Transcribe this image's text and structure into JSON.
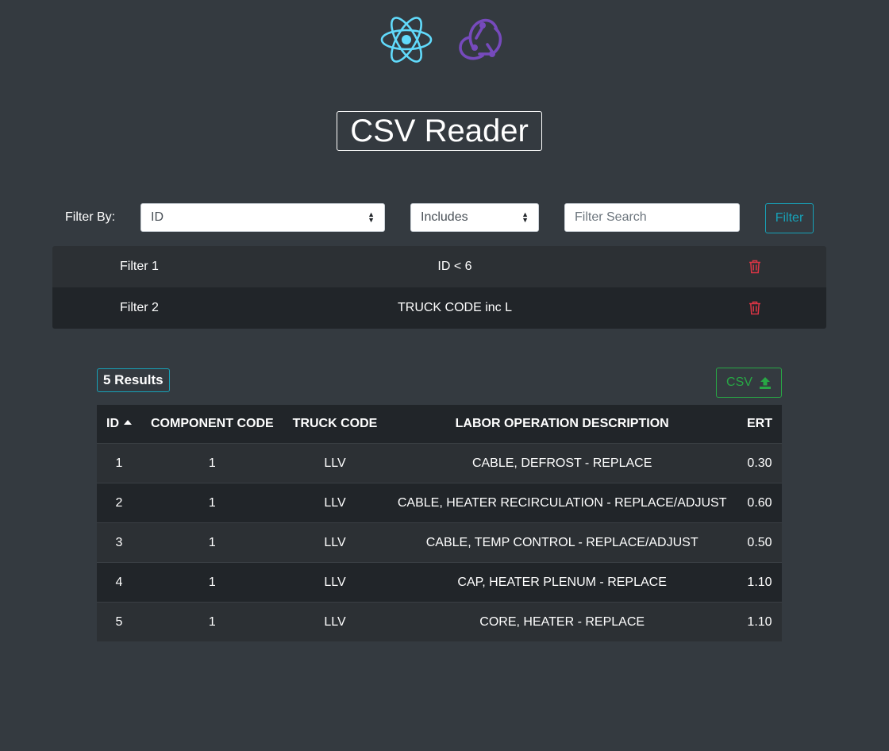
{
  "logos": {
    "react": "react-logo",
    "redux": "redux-logo",
    "react_color": "#61dafb",
    "redux_color": "#764abc"
  },
  "title": "CSV Reader",
  "filter_bar": {
    "label": "Filter By:",
    "field_select": {
      "selected": "ID"
    },
    "operator_select": {
      "selected": "Includes"
    },
    "search": {
      "value": "",
      "placeholder": "Filter Search"
    },
    "filter_button": "Filter"
  },
  "active_filters": [
    {
      "name": "Filter 1",
      "expression": "ID < 6"
    },
    {
      "name": "Filter 2",
      "expression": "TRUCK CODE inc L"
    }
  ],
  "results": {
    "count_label": "5 Results",
    "csv_button": "CSV",
    "columns": [
      "ID",
      "COMPONENT CODE",
      "TRUCK CODE",
      "LABOR OPERATION DESCRIPTION",
      "ERT"
    ],
    "sorted_column": "ID",
    "sort_direction": "ascending",
    "rows": [
      [
        "1",
        "1",
        "LLV",
        "CABLE, DEFROST - REPLACE",
        "0.30"
      ],
      [
        "2",
        "1",
        "LLV",
        "CABLE, HEATER RECIRCULATION - REPLACE/ADJUST",
        "0.60"
      ],
      [
        "3",
        "1",
        "LLV",
        "CABLE, TEMP CONTROL - REPLACE/ADJUST",
        "0.50"
      ],
      [
        "4",
        "1",
        "LLV",
        "CAP, HEATER PLENUM - REPLACE",
        "1.10"
      ],
      [
        "5",
        "1",
        "LLV",
        "CORE, HEATER - REPLACE",
        "1.10"
      ]
    ]
  },
  "colors": {
    "background": "#343a40",
    "info": "#17a2b8",
    "success": "#28a745",
    "danger": "#dc3545",
    "row_dark": "#212529",
    "row_light": "#2c3034"
  }
}
